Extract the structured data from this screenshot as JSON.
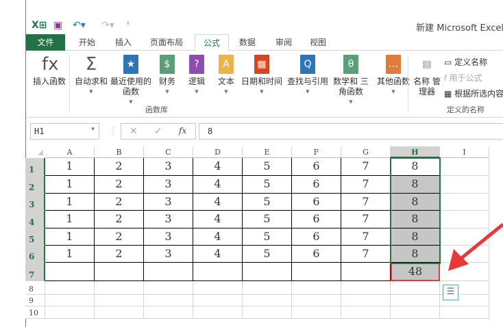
{
  "title": "新建 Microsoft Excel",
  "tabs": [
    {
      "label": "文件"
    },
    {
      "label": "开始"
    },
    {
      "label": "插入"
    },
    {
      "label": "页面布局"
    },
    {
      "label": "公式",
      "active": true
    },
    {
      "label": "数据"
    },
    {
      "label": "审阅"
    },
    {
      "label": "视图"
    }
  ],
  "ribbon": {
    "buttons": [
      {
        "label": "插入函数",
        "icon": "fx",
        "color": "#555"
      },
      {
        "label": "自动求和",
        "icon": "Σ",
        "color": "#555"
      },
      {
        "label": "最近使用的 函数",
        "icon": "★",
        "color": "#2e75b6"
      },
      {
        "label": "财务",
        "icon": "$",
        "color": "#5a9e7a"
      },
      {
        "label": "逻辑",
        "icon": "?",
        "color": "#8c4fb0"
      },
      {
        "label": "文本",
        "icon": "A",
        "color": "#e8b54a"
      },
      {
        "label": "日期和时间",
        "icon": "▦",
        "color": "#d24726"
      },
      {
        "label": "查找与引用",
        "icon": "Q",
        "color": "#2e75b6"
      },
      {
        "label": "数学和 三角函数",
        "icon": "θ",
        "color": "#5a9e7a"
      },
      {
        "label": "其他函数",
        "icon": "…",
        "color": "#e07b39"
      },
      {
        "label": "名称 管理器",
        "icon": "▤",
        "color": "#888"
      }
    ],
    "define_name": "定义名称",
    "use_in_formula": "用于公式",
    "create_from_selection": "根据所选内容",
    "group_function_library": "函数库",
    "group_defined_names": "定义的名称"
  },
  "formula_bar": {
    "name_box": "H1",
    "value": "8",
    "fx": "fx"
  },
  "columns": [
    "A",
    "B",
    "C",
    "D",
    "E",
    "F",
    "G",
    "H",
    "I"
  ],
  "rows": [
    [
      "1",
      "2",
      "3",
      "4",
      "5",
      "6",
      "7",
      "8"
    ],
    [
      "1",
      "2",
      "3",
      "4",
      "5",
      "6",
      "7",
      "8"
    ],
    [
      "1",
      "2",
      "3",
      "4",
      "5",
      "6",
      "7",
      "8"
    ],
    [
      "1",
      "2",
      "3",
      "4",
      "5",
      "6",
      "7",
      "8"
    ],
    [
      "1",
      "2",
      "3",
      "4",
      "5",
      "6",
      "7",
      "8"
    ],
    [
      "1",
      "2",
      "3",
      "4",
      "5",
      "6",
      "7",
      "8"
    ],
    [
      "",
      "",
      "",
      "",
      "",
      "",
      "",
      "48"
    ]
  ],
  "row_numbers": [
    "1",
    "2",
    "3",
    "4",
    "5",
    "6",
    "7",
    "8",
    "9",
    "10"
  ],
  "colors": {
    "accent": "#217346",
    "arrow": "#e8393a"
  }
}
